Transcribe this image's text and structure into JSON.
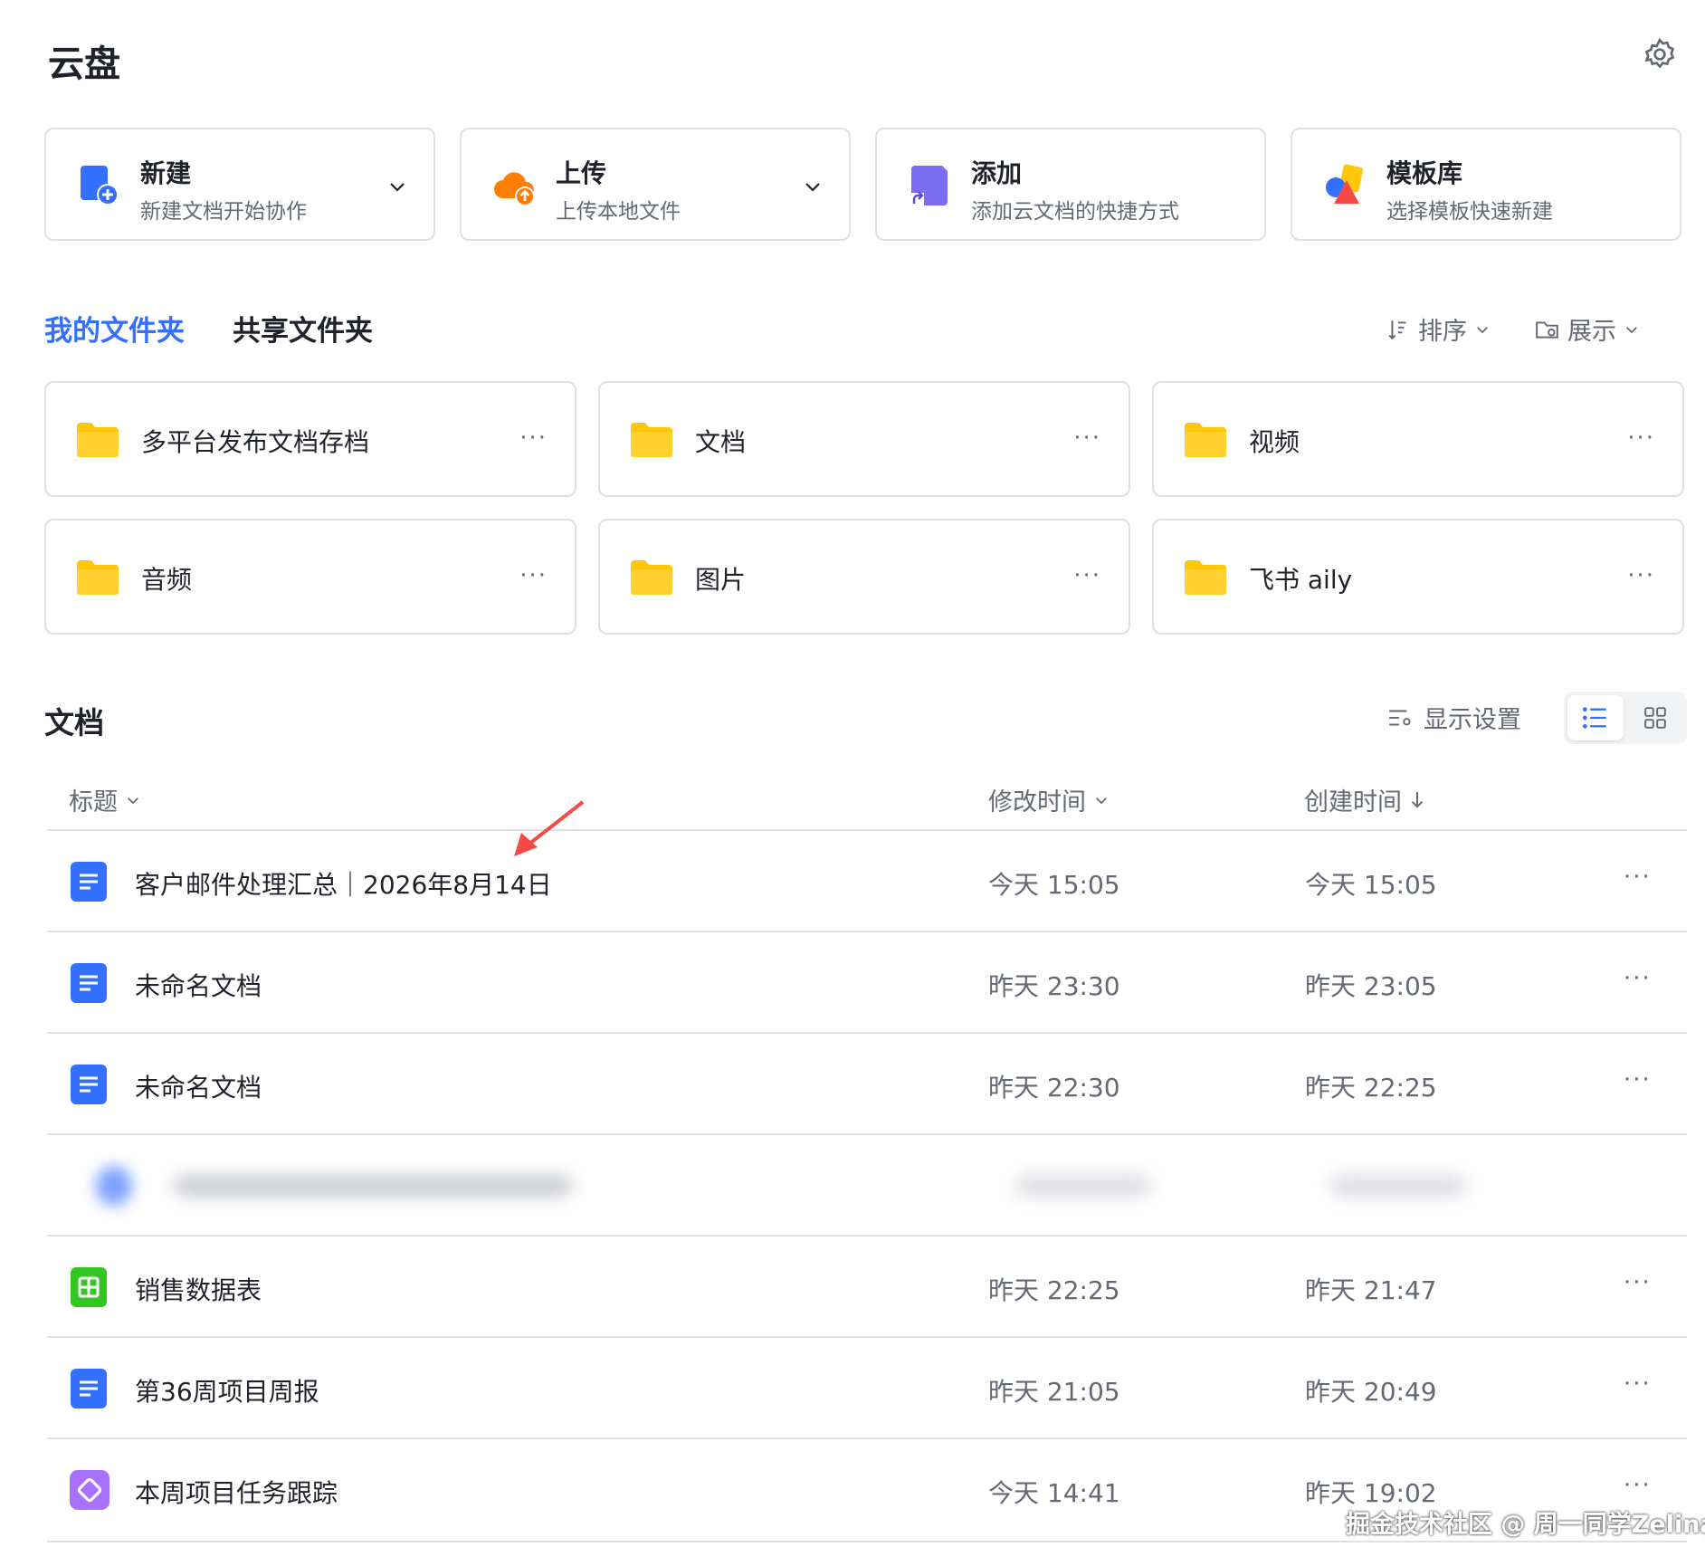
{
  "header": {
    "title": "云盘"
  },
  "actions": [
    {
      "title": "新建",
      "subtitle": "新建文档开始协作",
      "icon": "new-doc-icon"
    },
    {
      "title": "上传",
      "subtitle": "上传本地文件",
      "icon": "upload-cloud-icon"
    },
    {
      "title": "添加",
      "subtitle": "添加云文档的快捷方式",
      "icon": "shortcut-icon"
    },
    {
      "title": "模板库",
      "subtitle": "选择模板快速新建",
      "icon": "template-icon"
    }
  ],
  "tabs": {
    "mine": "我的文件夹",
    "shared": "共享文件夹"
  },
  "tools": {
    "sort": "排序",
    "display": "展示"
  },
  "folders": [
    {
      "name": "多平台发布文档存档"
    },
    {
      "name": "文档"
    },
    {
      "name": "视频"
    },
    {
      "name": "音频"
    },
    {
      "name": "图片"
    },
    {
      "name": "飞书 aily"
    }
  ],
  "docs_section": {
    "title": "文档",
    "display_settings": "显示设置",
    "columns": {
      "title": "标题",
      "modified": "修改时间",
      "created": "创建时间"
    }
  },
  "docs": [
    {
      "name": "客户邮件处理汇总｜2026年8月14日",
      "modified": "今天 15:05",
      "created": "今天 15:05",
      "type": "doc"
    },
    {
      "name": "未命名文档",
      "modified": "昨天 23:30",
      "created": "昨天 23:05",
      "type": "doc"
    },
    {
      "name": "未命名文档",
      "modified": "昨天 22:30",
      "created": "昨天 22:25",
      "type": "doc"
    },
    {
      "name": "",
      "modified": "",
      "created": "",
      "type": "blurred"
    },
    {
      "name": "销售数据表",
      "modified": "昨天 22:25",
      "created": "昨天 21:47",
      "type": "sheet"
    },
    {
      "name": "第36周项目周报",
      "modified": "昨天 21:05",
      "created": "昨天 20:49",
      "type": "doc"
    },
    {
      "name": "本周项目任务跟踪",
      "modified": "今天 14:41",
      "created": "昨天 19:02",
      "type": "base"
    }
  ],
  "more_label": "···",
  "watermark": "掘金技术社区 @ 周一同学Zelina",
  "colors": {
    "accent": "#3370ff",
    "folder": "#ffc60a",
    "doc": "#3370ff",
    "sheet": "#34c724",
    "base": "#a871ff",
    "upload": "#ff7d00"
  }
}
